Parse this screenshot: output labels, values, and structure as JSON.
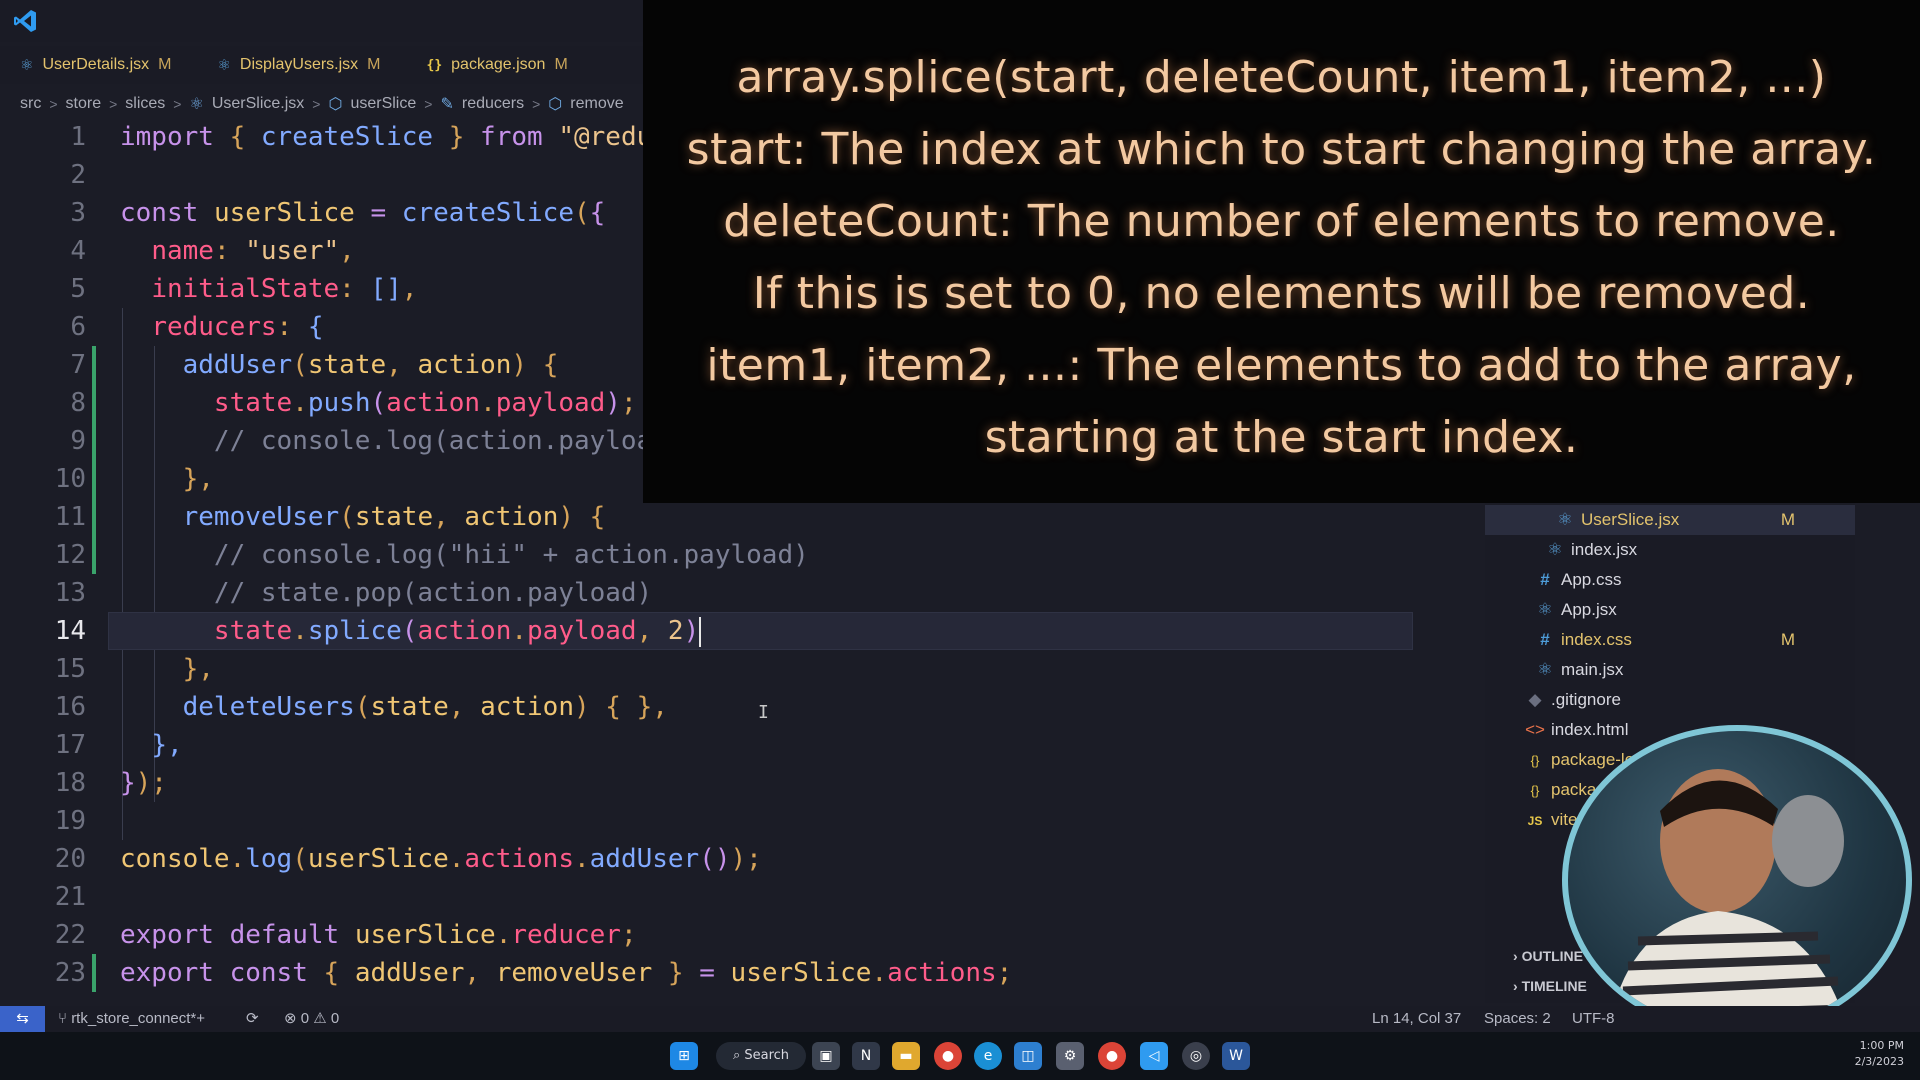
{
  "tabs": [
    {
      "icon": "react-icon",
      "label": "UserDetails.jsx",
      "mark": "M"
    },
    {
      "icon": "react-icon",
      "label": "DisplayUsers.jsx",
      "mark": "M"
    },
    {
      "icon": "json-icon",
      "label": "package.json",
      "mark": "M"
    }
  ],
  "breadcrumb": [
    "src",
    "store",
    "slices",
    "UserSlice.jsx",
    "userSlice",
    "reducers",
    "remove"
  ],
  "line_numbers": [
    "1",
    "2",
    "3",
    "4",
    "5",
    "6",
    "7",
    "8",
    "9",
    "10",
    "11",
    "12",
    "13",
    "14",
    "15",
    "16",
    "17",
    "18",
    "19",
    "20",
    "21",
    "22",
    "23"
  ],
  "active_line": "14",
  "overlay": {
    "lines": [
      "array.splice(start, deleteCount, item1, item2, ...)",
      "start: The index at which to start changing the array.",
      "deleteCount: The number of elements to remove.",
      "If this is set to 0, no elements will be removed.",
      "item1, item2, ...: The elements to add to the array,",
      "starting at the start index."
    ]
  },
  "explorer": {
    "items": [
      {
        "icon": "react-icon",
        "label": "UserSlice.jsx",
        "mark": "M",
        "selected": true
      },
      {
        "icon": "react-icon",
        "label": "index.jsx",
        "mark": ""
      },
      {
        "icon": "css-icon",
        "label": "App.css",
        "mark": ""
      },
      {
        "icon": "react-icon",
        "label": "App.jsx",
        "mark": ""
      },
      {
        "icon": "css-icon",
        "label": "index.css",
        "mark": "M"
      },
      {
        "icon": "react-icon",
        "label": "main.jsx",
        "mark": ""
      },
      {
        "icon": "git-icon",
        "label": ".gitignore",
        "mark": ""
      },
      {
        "icon": "html-icon",
        "label": "index.html",
        "mark": ""
      },
      {
        "icon": "json-icon",
        "label": "package-lock.",
        "mark": ""
      },
      {
        "icon": "json-icon",
        "label": "package.",
        "mark": ""
      },
      {
        "icon": "js-icon",
        "label": "vite.co",
        "mark": ""
      }
    ],
    "outline_label": "OUTLINE",
    "timeline_label": "TIMELINE"
  },
  "status": {
    "branch": "rtk_store_connect*+",
    "errors": "0",
    "warnings": "0",
    "position": "Ln 14, Col 37",
    "spaces": "Spaces: 2",
    "encoding": "UTF-8"
  },
  "taskbar": {
    "search_label": "Search",
    "time": "1:00 PM",
    "date": "2/3/2023"
  },
  "colors": {
    "keyword": "#c792ea",
    "function": "#82aaff",
    "string": "#ecc48d",
    "property": "#ff5c8a",
    "comment": "#7d8196",
    "overlay_text": "#f3c9a1",
    "accent": "#3a63c9"
  }
}
